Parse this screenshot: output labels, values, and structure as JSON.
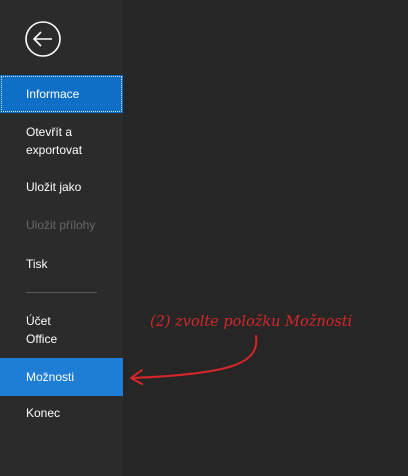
{
  "sidebar": {
    "items": [
      {
        "label": "Informace",
        "state": "selected"
      },
      {
        "label": "Otevřít a exportovat",
        "label_line1": "Otevřít a",
        "label_line2": "exportovat"
      },
      {
        "label": "Uložit jako"
      },
      {
        "label": "Uložit přílohy",
        "state": "disabled"
      },
      {
        "label": "Tisk"
      },
      {
        "label": "Účet Office",
        "label_line1": "Účet",
        "label_line2": "Office"
      },
      {
        "label": "Možnosti",
        "state": "active"
      },
      {
        "label": "Konec"
      }
    ],
    "back_icon": "back-arrow-circle-icon"
  },
  "annotation": {
    "text": "(2) zvolte položku Možnosti",
    "color": "#d6262a"
  },
  "colors": {
    "sidebar_bg": "#2b2b2b",
    "content_bg": "#262626",
    "selected_bg": "#0f6fc6",
    "active_bg": "#1e7ed6",
    "text": "#ffffff",
    "disabled_text": "#666666"
  }
}
